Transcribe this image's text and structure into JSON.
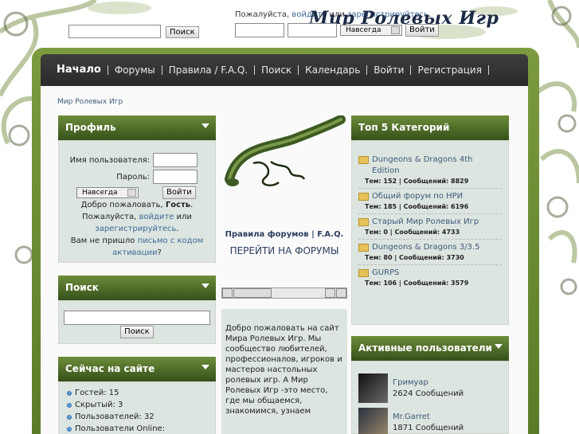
{
  "header": {
    "search_button": "Поиск",
    "login_hint_prefix": "Пожалуйста, ",
    "login_link": "войдите",
    "login_hint_mid": " или ",
    "register_link": "зарегистрируйтесь",
    "login_hint_suffix": ".",
    "site_title": "Мир Ролевых Игр",
    "remember_option": "Навсегда",
    "login_button": "Войти"
  },
  "nav": {
    "items": [
      "Начало",
      "Форумы",
      "Правила / F.A.Q.",
      "Поиск",
      "Календарь",
      "Войти",
      "Регистрация"
    ]
  },
  "breadcrumb": "Мир Ролевых Игр",
  "profile": {
    "title": "Профиль",
    "username_label": "Имя пользователя:",
    "password_label": "Пароль:",
    "remember_option": "Навсегда",
    "login_button": "Войти",
    "welcome_prefix": "Добро пожаловать, ",
    "guest": "Гость",
    "welcome_suffix": ".",
    "please": "Пожалуйста, ",
    "login_link": "войдите",
    "or": " или ",
    "register_link": "зарегистрируйтесь",
    "period": ".",
    "activation_prefix": "Вам не пришло ",
    "activation_link": "письмо с кодом активации",
    "activation_suffix": "?"
  },
  "search_panel": {
    "title": "Поиск",
    "button": "Поиск"
  },
  "online": {
    "title": "Сейчас на сайте",
    "items": [
      "Гостей: 15",
      "Скрытый: 3",
      "Пользователей: 32",
      "Пользователи Online:"
    ]
  },
  "center": {
    "rules_link": "Правила форумов | F.A.Q.",
    "go_forums": "ПЕРЕЙТИ НА ФОРУМЫ",
    "welcome_text": "Добро пожаловать на сайт Мира Ролевых Игр. Мы   сообщество любителей, профессионалов, игроков и мастеров настольных ролевых игр. А Мир Ролевых Игр  -это место, где мы общаемся, знакомимся, узнаем"
  },
  "top_categories": {
    "title": "Топ 5 Категорий",
    "items": [
      {
        "name": "Dungeons & Dragons 4th Edition",
        "stats": "Тем: 152 | Сообщений: 8829"
      },
      {
        "name": "Общий форум по НРИ",
        "stats": "Тем: 185 | Сообщений: 6196"
      },
      {
        "name": "Старый Мир Ролевых Игр",
        "stats": "Тем: 0 | Сообщений: 4733"
      },
      {
        "name": "Dungeons & Dragons 3/3.5",
        "stats": "Тем: 80 | Сообщений: 3730"
      },
      {
        "name": "GURPS",
        "stats": "Тем: 106 | Сообщений: 3579"
      }
    ]
  },
  "active_users": {
    "title": "Активные пользователи",
    "items": [
      {
        "name": "Гримуар",
        "posts": "2624 Сообщений"
      },
      {
        "name": "Mr.Garret",
        "posts": "1871 Сообщений"
      }
    ]
  },
  "colors": {
    "panel_header": "#4f6d28",
    "nav_bg": "#333333",
    "link": "#3b6a9a",
    "panel_body": "#dde5e0"
  }
}
